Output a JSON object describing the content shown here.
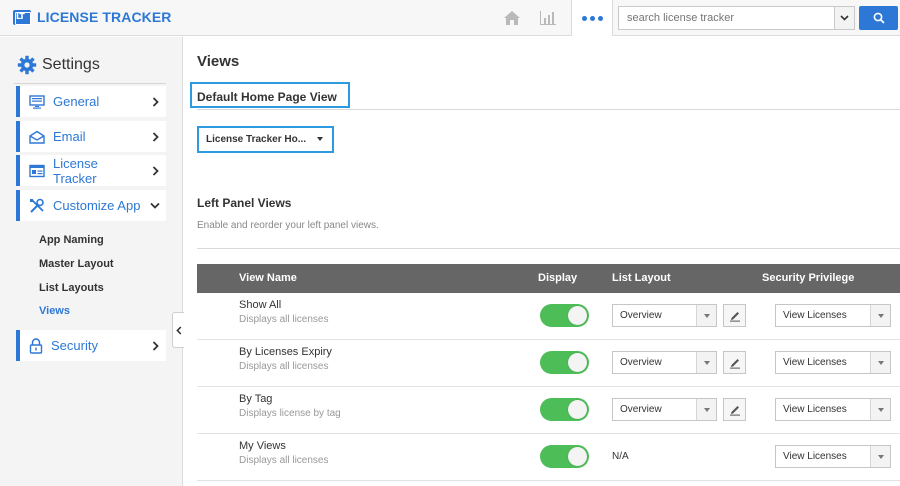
{
  "app": {
    "logo_mark": "LT",
    "title": "LICENSE TRACKER"
  },
  "topbar": {
    "search_placeholder": "search license tracker"
  },
  "sidebar": {
    "heading": "Settings",
    "items": [
      {
        "label": "General",
        "icon": "monitor-icon"
      },
      {
        "label": "Email",
        "icon": "envelope-icon"
      },
      {
        "label": "License Tracker",
        "icon": "license-card-icon"
      },
      {
        "label": "Customize App",
        "icon": "tools-icon",
        "expanded": true
      },
      {
        "label": "Security",
        "icon": "lock-icon"
      }
    ],
    "subitems": [
      "App Naming",
      "Master Layout",
      "List Layouts",
      "Views"
    ],
    "active_subitem": "Views"
  },
  "main": {
    "title": "Views",
    "default_home": {
      "heading": "Default Home Page View",
      "selected": "License Tracker Ho..."
    },
    "left_panel": {
      "heading": "Left Panel Views",
      "description": "Enable and reorder your left panel views."
    },
    "table": {
      "columns": [
        "View Name",
        "Display",
        "List Layout",
        "Security Privilege"
      ],
      "rows": [
        {
          "name": "Show All",
          "desc": "Displays all licenses",
          "display": true,
          "layout": "Overview",
          "privilege": "View Licenses"
        },
        {
          "name": "By Licenses Expiry",
          "desc": "Displays all licenses",
          "display": true,
          "layout": "Overview",
          "privilege": "View Licenses"
        },
        {
          "name": "By Tag",
          "desc": "Displays license by tag",
          "display": true,
          "layout": "Overview",
          "privilege": "View Licenses"
        },
        {
          "name": "My Views",
          "desc": "Displays all licenses",
          "display": true,
          "layout": "N/A",
          "privilege": "View Licenses"
        }
      ]
    }
  },
  "colors": {
    "accent": "#2d78d6",
    "highlight": "#2d9be0",
    "toggle_on": "#4dbd57",
    "table_header": "#666666"
  }
}
